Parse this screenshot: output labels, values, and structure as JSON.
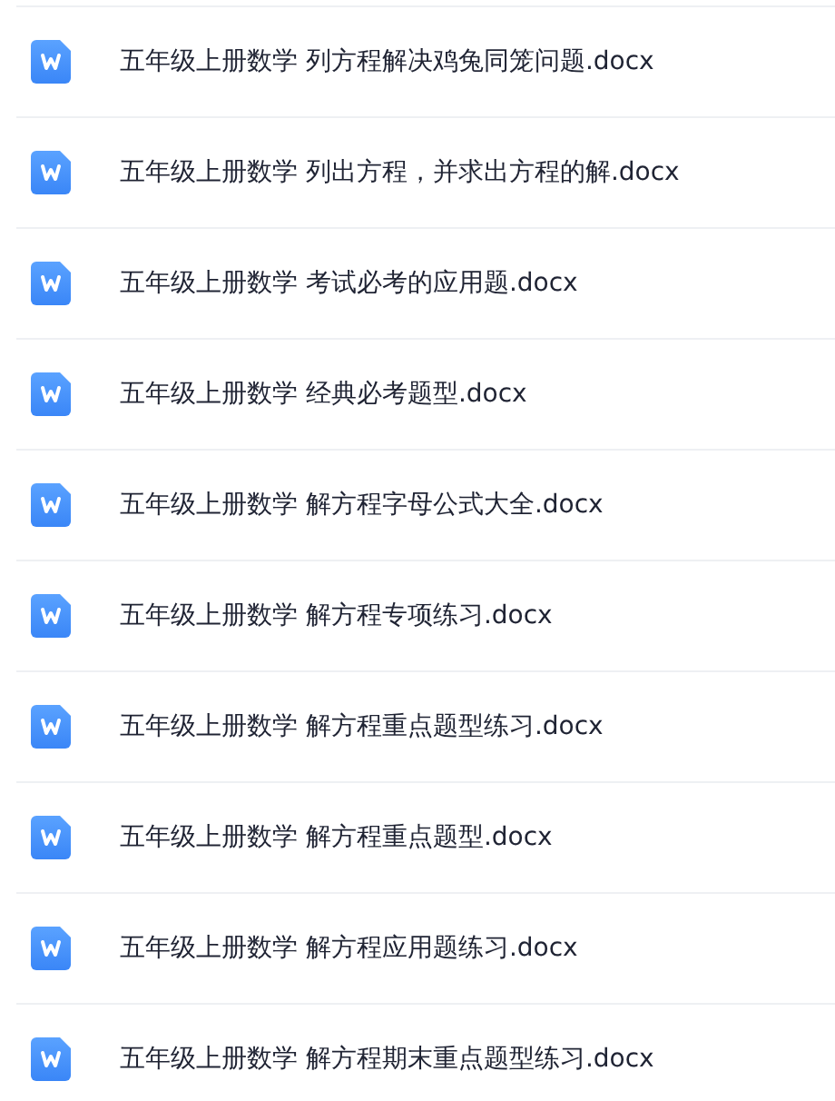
{
  "files": [
    {
      "name": "五年级上册数学 列方程解决鸡兔同笼问题.docx"
    },
    {
      "name": "五年级上册数学 列出方程，并求出方程的解.docx"
    },
    {
      "name": "五年级上册数学 考试必考的应用题.docx"
    },
    {
      "name": "五年级上册数学 经典必考题型.docx"
    },
    {
      "name": "五年级上册数学 解方程字母公式大全.docx"
    },
    {
      "name": "五年级上册数学 解方程专项练习.docx"
    },
    {
      "name": "五年级上册数学 解方程重点题型练习.docx"
    },
    {
      "name": "五年级上册数学 解方程重点题型.docx"
    },
    {
      "name": "五年级上册数学 解方程应用题练习.docx"
    },
    {
      "name": "五年级上册数学 解方程期末重点题型练习.docx"
    }
  ]
}
